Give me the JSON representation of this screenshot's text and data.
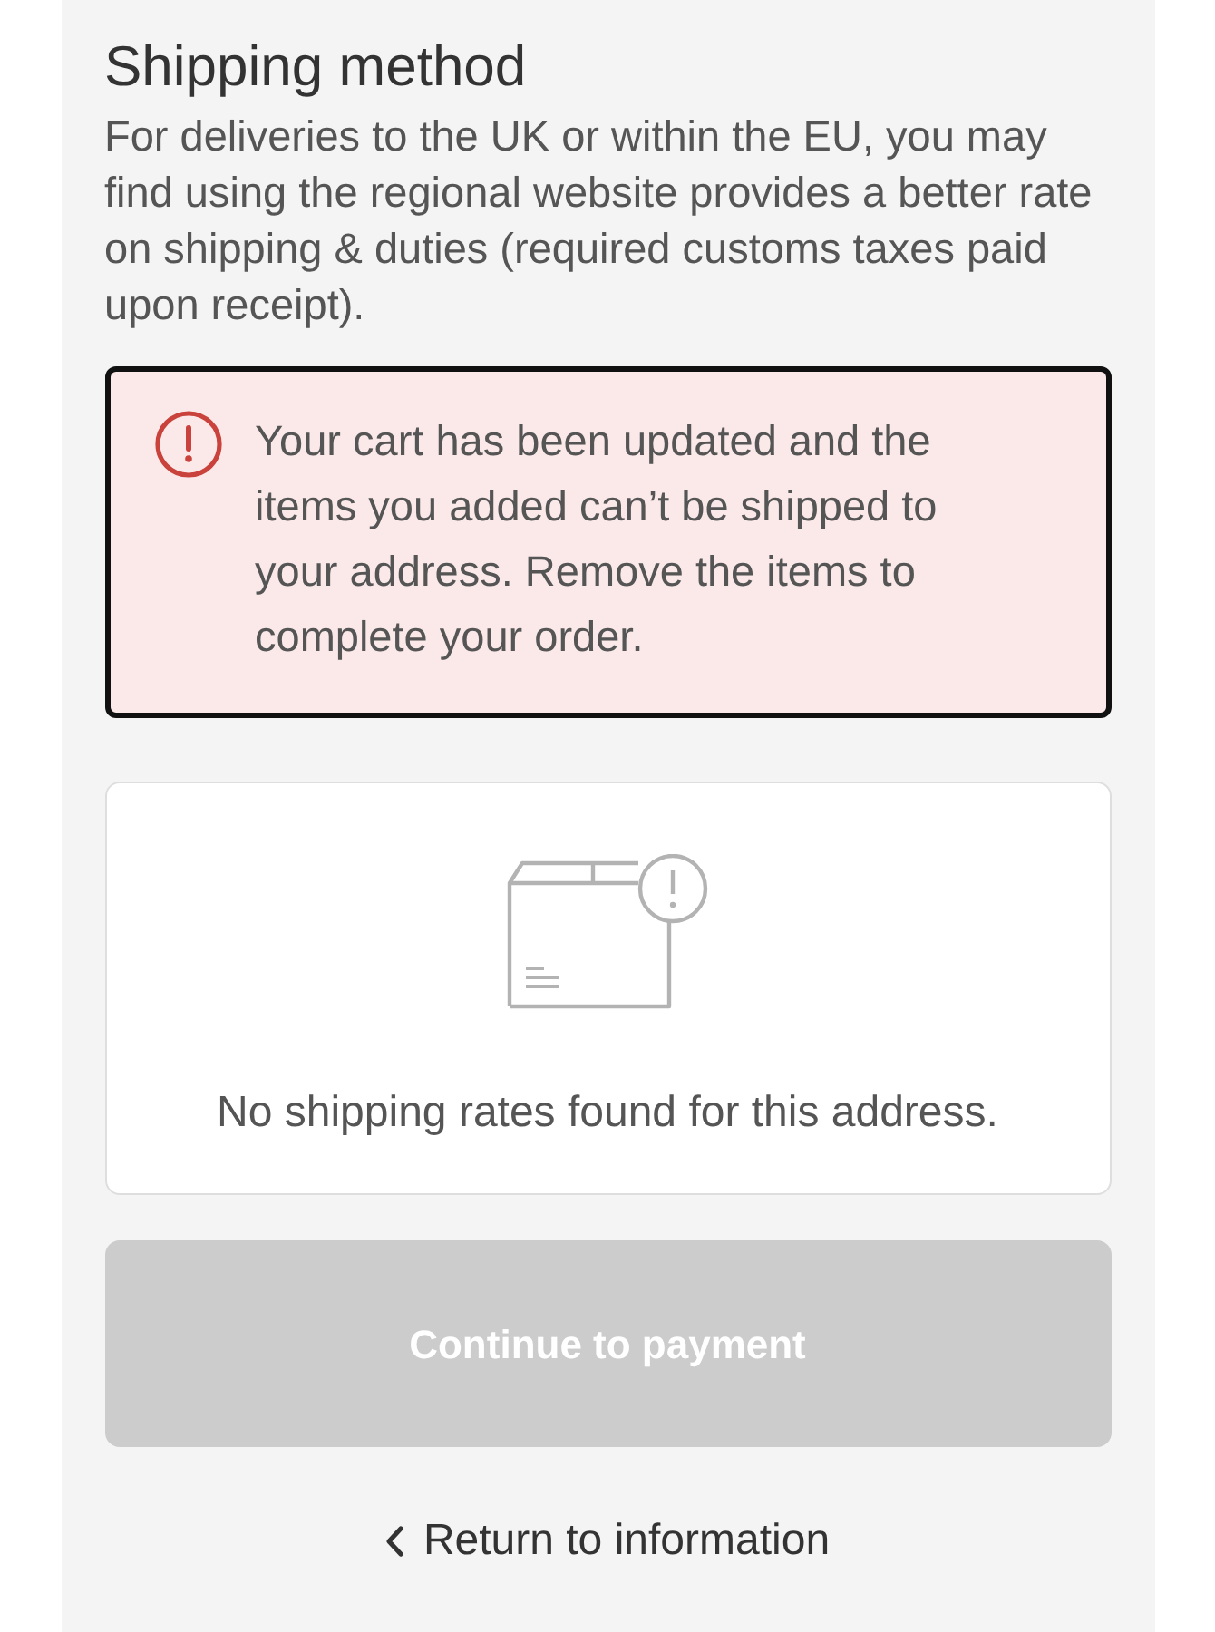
{
  "heading": "Shipping method",
  "description": "For deliveries to the UK or within the EU, you may find using the regional website provides a better rate on shipping & duties (required customs taxes paid upon receipt).",
  "alert": {
    "kind": "error",
    "message": "Your cart has been updated and the items you added can’t be shipped to your address. Remove the items to complete your order."
  },
  "empty_state": {
    "message": "No shipping rates found for this address."
  },
  "continue_button": {
    "label": "Continue to payment",
    "disabled": true
  },
  "back_link": {
    "label": "Return to information"
  }
}
